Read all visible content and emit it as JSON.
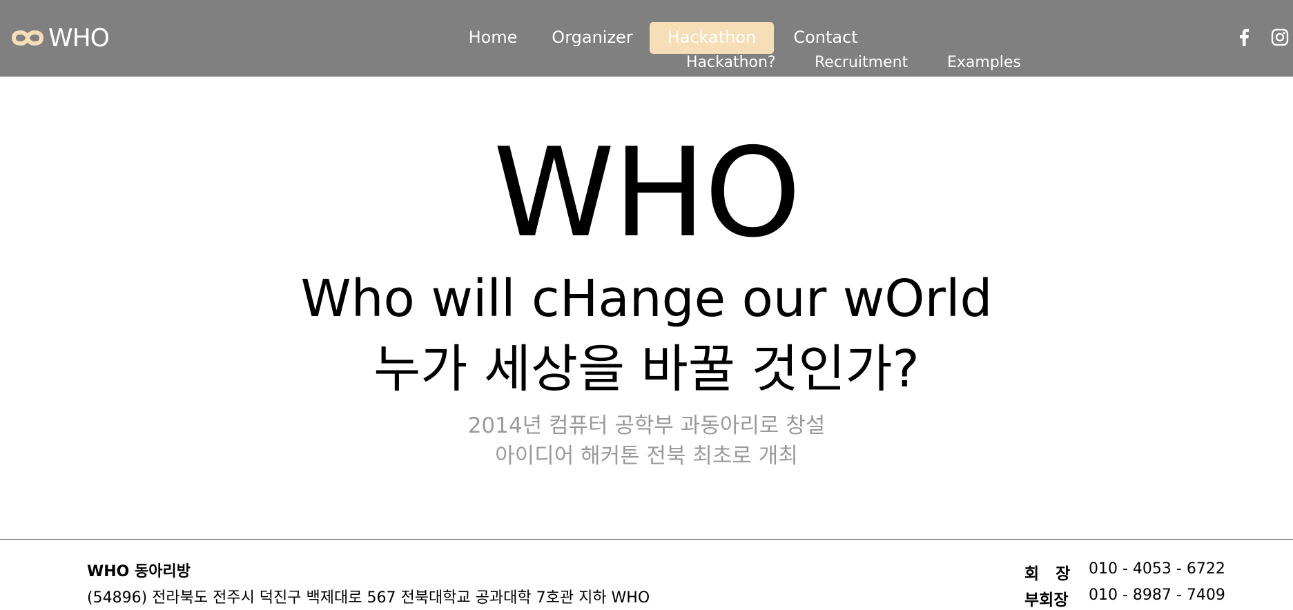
{
  "header": {
    "logo_text": "WHO",
    "nav": [
      {
        "label": "Home"
      },
      {
        "label": "Organizer"
      },
      {
        "label": "Hackathon",
        "active": true
      },
      {
        "label": "Contact"
      }
    ],
    "subnav": [
      {
        "label": "Hackathon?"
      },
      {
        "label": "Recruitment"
      },
      {
        "label": "Examples"
      }
    ],
    "social": [
      "facebook-icon",
      "instagram-icon"
    ],
    "accent_color": "#f6deb6",
    "bar_color": "#808080"
  },
  "hero": {
    "title": "WHO",
    "subtitle_en": "Who will cHange our wOrld",
    "subtitle_ko": "누가 세상을 바꿀 것인가?",
    "desc_line1": "2014년 컴퓨터 공학부 과동아리로 창설",
    "desc_line2": "아이디어 해커톤 전북 최초로 개최"
  },
  "footer": {
    "club_room": "WHO 동아리방",
    "address": "(54896) 전라북도 전주시 덕진구 백제대로 567 전북대학교 공과대학 7호관 지하 WHO",
    "contacts": [
      {
        "role": "회   장",
        "phone": "010 - 4053 - 6722"
      },
      {
        "role": "부회장",
        "phone": "010 - 8987 - 7409"
      }
    ]
  }
}
